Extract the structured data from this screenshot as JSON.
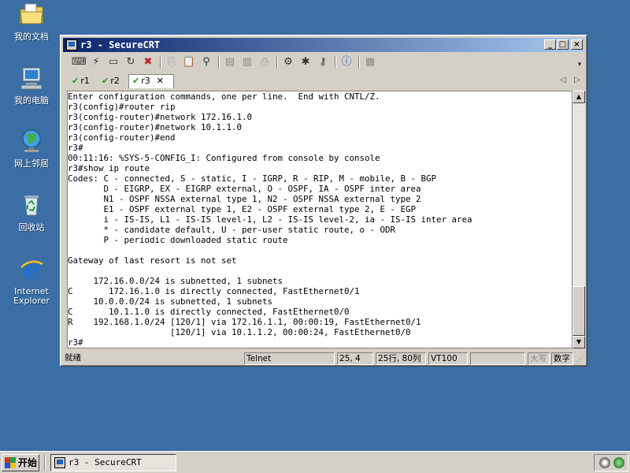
{
  "desktop": {
    "icons": [
      {
        "label": "我的文档"
      },
      {
        "label": "我的电脑"
      },
      {
        "label": "网上邻居"
      },
      {
        "label": "回收站"
      },
      {
        "label": "Internet Explorer"
      }
    ]
  },
  "window": {
    "title": "r3 - SecureCRT",
    "tabs": [
      {
        "label": "r1"
      },
      {
        "label": "r2"
      },
      {
        "label": "r3"
      }
    ],
    "terminal_lines": [
      "Enter configuration commands, one per line.  End with CNTL/Z.",
      "r3(config)#router rip",
      "r3(config-router)#network 172.16.1.0",
      "r3(config-router)#network 10.1.1.0",
      "r3(config-router)#end",
      "r3#",
      "00:11:16: %SYS-5-CONFIG_I: Configured from console by console",
      "r3#show ip route",
      "Codes: C - connected, S - static, I - IGRP, R - RIP, M - mobile, B - BGP",
      "       D - EIGRP, EX - EIGRP external, O - OSPF, IA - OSPF inter area",
      "       N1 - OSPF NSSA external type 1, N2 - OSPF NSSA external type 2",
      "       E1 - OSPF external type 1, E2 - OSPF external type 2, E - EGP",
      "       i - IS-IS, L1 - IS-IS level-1, L2 - IS-IS level-2, ia - IS-IS inter area",
      "       * - candidate default, U - per-user static route, o - ODR",
      "       P - periodic downloaded static route",
      "",
      "Gateway of last resort is not set",
      "",
      "     172.16.0.0/24 is subnetted, 1 subnets",
      "C       172.16.1.0 is directly connected, FastEthernet0/1",
      "     10.0.0.0/24 is subnetted, 1 subnets",
      "C       10.1.1.0 is directly connected, FastEthernet0/0",
      "R    192.168.1.0/24 [120/1] via 172.16.1.1, 00:00:19, FastEthernet0/1",
      "                    [120/1] via 10.1.1.2, 00:00:24, FastEthernet0/0",
      "r3#"
    ],
    "status": {
      "ready": "就绪",
      "protocol": "Telnet",
      "cursor": "25,  4",
      "size": "25行, 80列",
      "emulation": "VT100",
      "blank": "",
      "caps": "大写",
      "num": "数字"
    }
  },
  "taskbar": {
    "start_label": "开始",
    "task_label": "r3 - SecureCRT"
  }
}
